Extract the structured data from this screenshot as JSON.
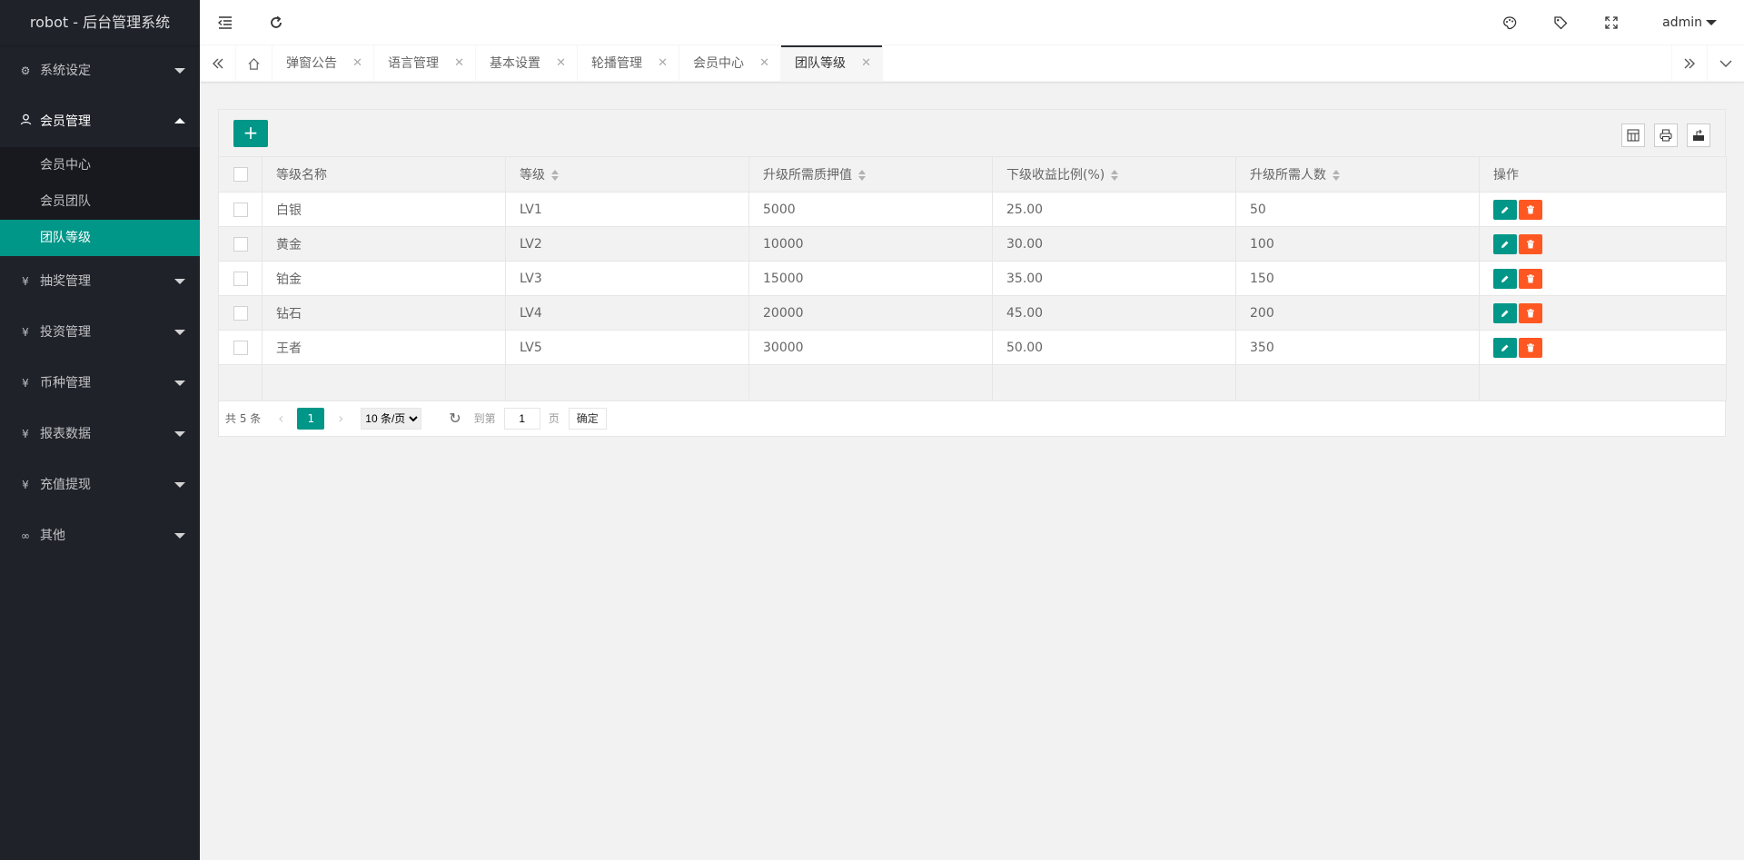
{
  "app": {
    "title": "robot - 后台管理系统"
  },
  "sidebar": {
    "items": [
      {
        "label": "系统设定",
        "icon": "gear-icon",
        "open": false
      },
      {
        "label": "会员管理",
        "icon": "user-icon",
        "open": true,
        "children": [
          {
            "label": "会员中心",
            "active": false
          },
          {
            "label": "会员团队",
            "active": false
          },
          {
            "label": "团队等级",
            "active": true
          }
        ]
      },
      {
        "label": "抽奖管理",
        "icon": "yen-icon",
        "open": false
      },
      {
        "label": "投资管理",
        "icon": "yen-icon",
        "open": false
      },
      {
        "label": "币种管理",
        "icon": "yen-icon",
        "open": false
      },
      {
        "label": "报表数据",
        "icon": "yen-icon",
        "open": false
      },
      {
        "label": "充值提现",
        "icon": "yen-icon",
        "open": false
      },
      {
        "label": "其他",
        "icon": "link-icon",
        "open": false
      }
    ]
  },
  "header": {
    "user": "admin"
  },
  "tabs": [
    {
      "label": "弹窗公告",
      "active": false
    },
    {
      "label": "语言管理",
      "active": false
    },
    {
      "label": "基本设置",
      "active": false
    },
    {
      "label": "轮播管理",
      "active": false
    },
    {
      "label": "会员中心",
      "active": false
    },
    {
      "label": "团队等级",
      "active": true
    }
  ],
  "toolbar": {
    "add_label": "+"
  },
  "table": {
    "columns": [
      "等级名称",
      "等级",
      "升级所需质押值",
      "下级收益比例(%)",
      "升级所需人数",
      "操作"
    ],
    "rows": [
      [
        "白银",
        "LV1",
        "5000",
        "25.00",
        "50"
      ],
      [
        "黄金",
        "LV2",
        "10000",
        "30.00",
        "100"
      ],
      [
        "铂金",
        "LV3",
        "15000",
        "35.00",
        "150"
      ],
      [
        "钻石",
        "LV4",
        "20000",
        "45.00",
        "200"
      ],
      [
        "王者",
        "LV5",
        "30000",
        "50.00",
        "350"
      ]
    ]
  },
  "pager": {
    "count": "共 5 条",
    "current": "1",
    "page_size": "10 条/页",
    "goto_label": "到第",
    "goto_value": "1",
    "page_unit": "页",
    "ok_label": "确定"
  },
  "colors": {
    "accent": "#009688",
    "danger": "#ff5722",
    "sidebar": "#20222a"
  }
}
